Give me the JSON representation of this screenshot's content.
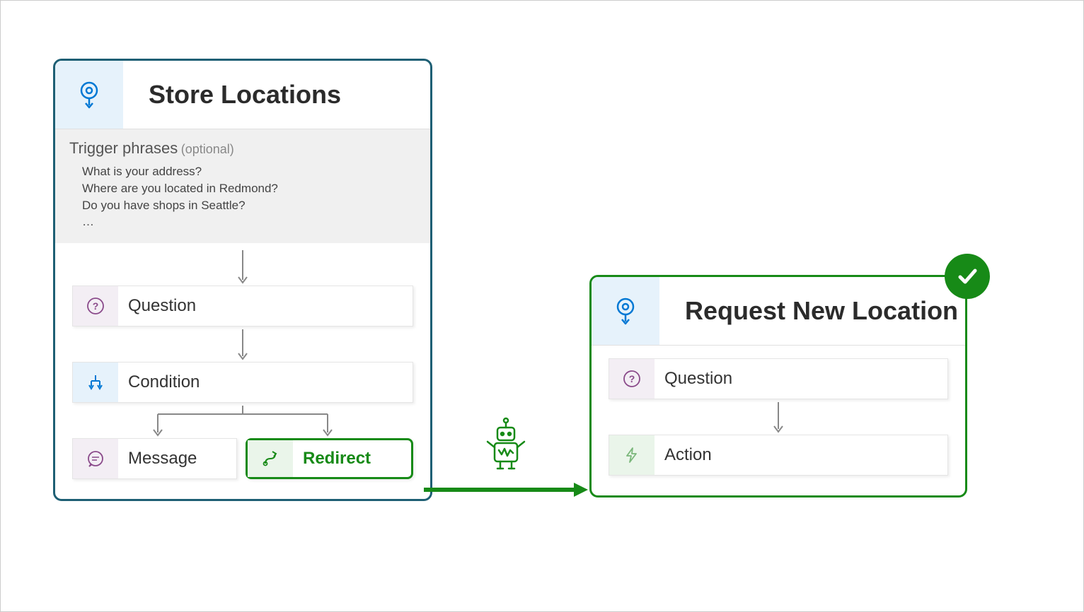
{
  "left_card": {
    "title": "Store Locations",
    "trigger_label": "Trigger phrases",
    "trigger_optional": "(optional)",
    "triggers": [
      "What is your address?",
      "Where are you located in Redmond?",
      "Do you have shops in Seattle?",
      "…"
    ],
    "nodes": {
      "question": "Question",
      "condition": "Condition",
      "message": "Message",
      "redirect": "Redirect"
    }
  },
  "right_card": {
    "title": "Request New Location",
    "nodes": {
      "question": "Question",
      "action": "Action"
    }
  }
}
